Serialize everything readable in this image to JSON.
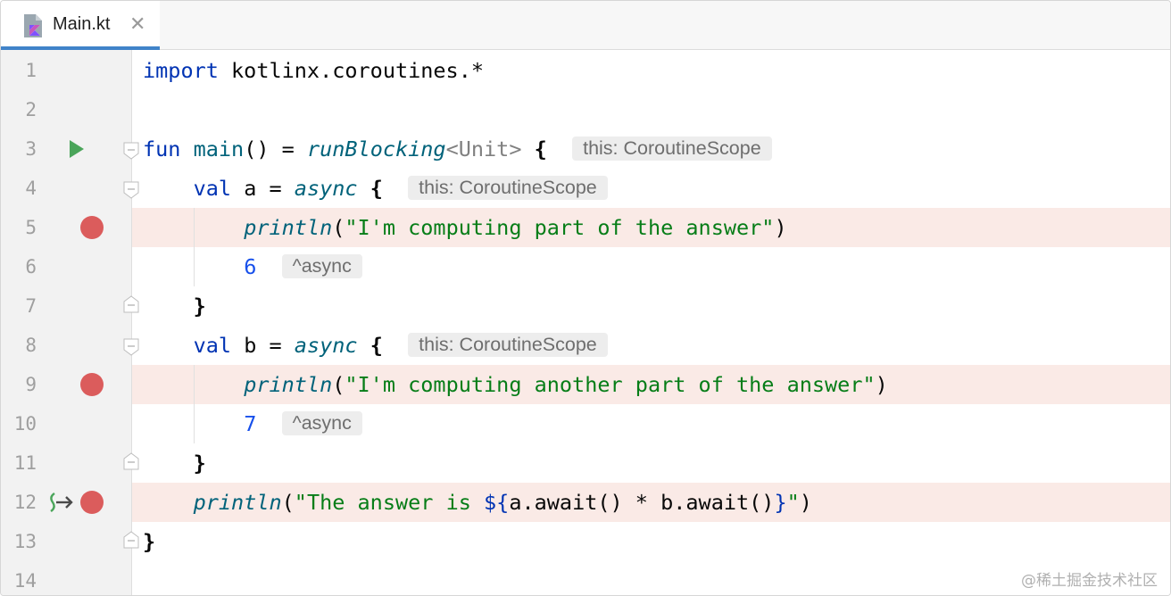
{
  "tab": {
    "file_name": "Main.kt",
    "close_glyph": "✕",
    "icon": "kotlin-file-icon"
  },
  "colors": {
    "accent": "#4083c9",
    "keyword": "#0033b3",
    "function": "#00627a",
    "string": "#067d17",
    "number": "#1750eb",
    "breakpoint": "#db5c5c",
    "breakpoint_line": "#faeae6",
    "run_gutter": "#4aa55a"
  },
  "editor": {
    "line_numbers": [
      "1",
      "2",
      "3",
      "4",
      "5",
      "6",
      "7",
      "8",
      "9",
      "10",
      "11",
      "12",
      "13",
      "14"
    ],
    "lines": {
      "l1": {
        "kw": "import",
        "rest": " kotlinx.coroutines.*"
      },
      "l3": {
        "kw": "fun",
        "name": "main",
        "sig": "() = ",
        "call": "runBlocking",
        "type": "<Unit>",
        "brace": "{",
        "hint": "this: CoroutineScope"
      },
      "l4": {
        "indent": "    ",
        "kw": "val",
        "rest": " a = ",
        "call": "async",
        "brace": "{",
        "hint": "this: CoroutineScope"
      },
      "l5": {
        "indent": "        ",
        "call": "println",
        "open": "(",
        "str": "\"I'm computing part of the answer\"",
        "close": ")"
      },
      "l6": {
        "indent": "        ",
        "num": "6",
        "hint": "^async"
      },
      "l7": {
        "indent": "    ",
        "brace": "}"
      },
      "l8": {
        "indent": "    ",
        "kw": "val",
        "rest": " b = ",
        "call": "async",
        "brace": "{",
        "hint": "this: CoroutineScope"
      },
      "l9": {
        "indent": "        ",
        "call": "println",
        "open": "(",
        "str": "\"I'm computing another part of the answer\"",
        "close": ")"
      },
      "l10": {
        "indent": "        ",
        "num": "7",
        "hint": "^async"
      },
      "l11": {
        "indent": "    ",
        "brace": "}"
      },
      "l12": {
        "indent": "    ",
        "call": "println",
        "open": "(",
        "str1": "\"The answer is ",
        "tmpl_open": "${",
        "expr": "a.await() * b.await()",
        "tmpl_close": "}",
        "str2": "\"",
        "close": ")"
      },
      "l13": {
        "brace": "}"
      }
    },
    "breakpoint_lines": [
      5,
      9,
      12
    ]
  },
  "watermark": "@稀土掘金技术社区"
}
